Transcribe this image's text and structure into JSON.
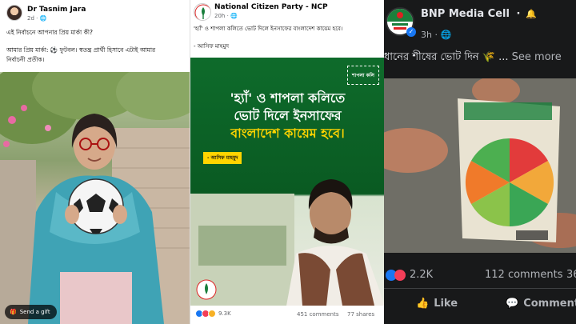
{
  "post1": {
    "author": "Dr Tasnim Jara",
    "time": "2d · ",
    "line1": "এই নির্বাচনে আপনার প্রিয় মার্কা কী?",
    "line2": "আমার প্রিয় মার্কা: ⚽ ফুটবল। স্বতন্ত্র প্রার্থী হিসাবে এটাই আমার",
    "line3": "নির্বাচনী প্রতীক।",
    "gift_label": "Send a gift"
  },
  "post2": {
    "author": "National Citizen Party - NCP",
    "time": "20h · ",
    "quote": "'হ্যাঁ' ও শাপলা কলিতে ভোট দিলে ইনসাফের বাংলাদেশ কায়েম হবে।",
    "attribution": "- আসিফ মাহমুদ",
    "poster_line1": "'হ্যাঁ' ও শাপলা কলিতে",
    "poster_line2": "ভোট দিলে ইনসাফের",
    "poster_line3": "বাংলাদেশ কায়েম হবে।",
    "poster_name": "- আসিফ মাহমুদ",
    "poster_badge": "শাপলা কলি",
    "reactions": "9.3K",
    "comments": "451 comments",
    "shares": "77 shares"
  },
  "post3": {
    "author": "BNP Media Cell",
    "time": "3h · ",
    "text": "ধানের শীষের ভোট দিন 🌾 ...",
    "see_more": "See more",
    "reactions": "2.2K",
    "comments": "112 comments",
    "shares": "36",
    "like_label": "Like",
    "comment_label": "Comment"
  },
  "colors": {
    "fb_blue": "#1877f2",
    "love_red": "#f33e58",
    "poster_green": "#0a5a22",
    "poster_yellow": "#ffd400"
  }
}
